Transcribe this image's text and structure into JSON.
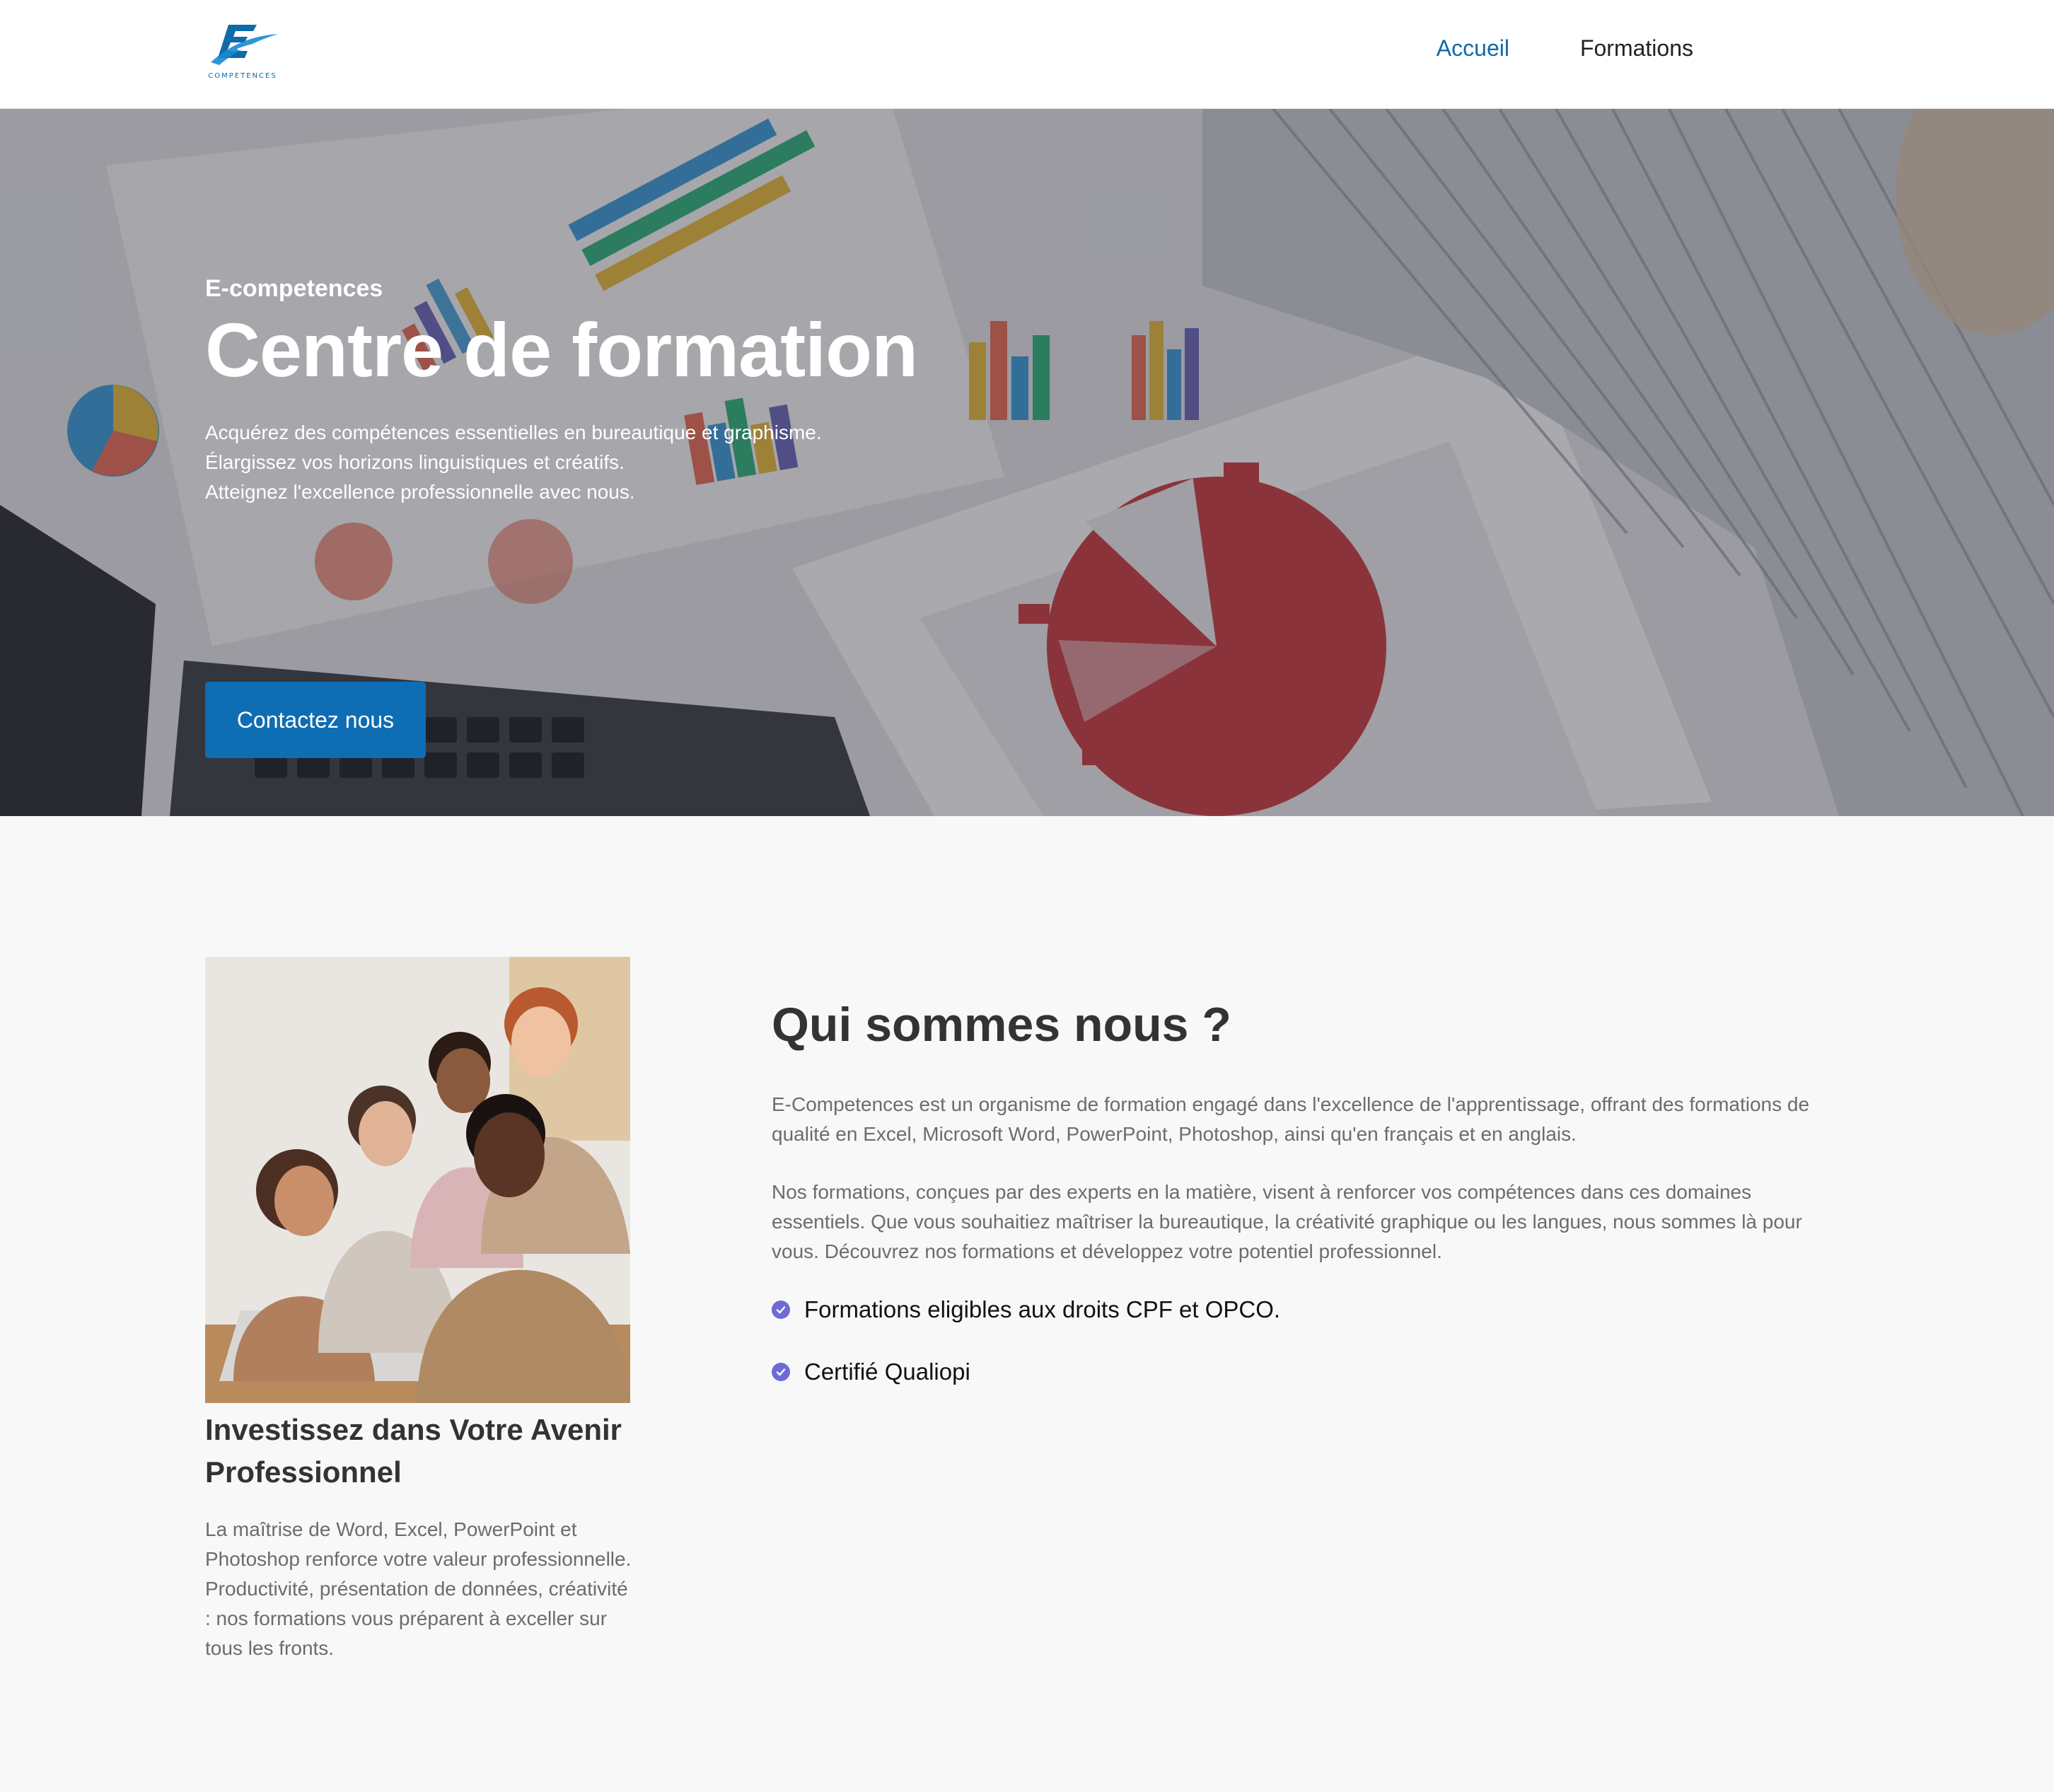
{
  "header": {
    "logo_text": "COMPETENCES",
    "nav": [
      {
        "label": "Accueil",
        "active": true
      },
      {
        "label": "Formations",
        "active": false
      }
    ]
  },
  "hero": {
    "kicker": "E-competences",
    "title": "Centre de formation",
    "lines": [
      "Acquérez des compétences essentielles en bureautique et graphisme.",
      "Élargissez vos horizons linguistiques et créatifs.",
      "Atteignez l'excellence professionnelle avec nous."
    ],
    "cta_label": "Contactez nous"
  },
  "about": {
    "left_title": "Investissez dans Votre Avenir Professionnel",
    "left_text": "La maîtrise de Word, Excel, PowerPoint et Photoshop renforce votre valeur professionnelle. Productivité, présentation de données, créativité : nos formations vous préparent à exceller sur tous les fronts.",
    "title": "Qui sommes nous ?",
    "paragraphs": [
      "E-Competences est un organisme de formation engagé dans l'excellence de l'apprentissage, offrant des formations de qualité en Excel, Microsoft Word, PowerPoint, Photoshop, ainsi qu'en français et en anglais.",
      "Nos formations, conçues par des experts en la matière, visent à renforcer vos compétences dans ces domaines essentiels. Que vous souhaitiez maîtriser la bureautique, la créativité graphique ou les langues, nous sommes là pour vous. Découvrez nos formations et développez votre potentiel professionnel."
    ],
    "checks": [
      "Formations eligibles aux droits CPF et OPCO.",
      "Certifié Qualiopi"
    ]
  },
  "colors": {
    "brand_blue": "#0e6db3",
    "nav_active": "#0f6aa8",
    "check_purple": "#6e6bd8",
    "page_bg": "#f8f8f8"
  }
}
